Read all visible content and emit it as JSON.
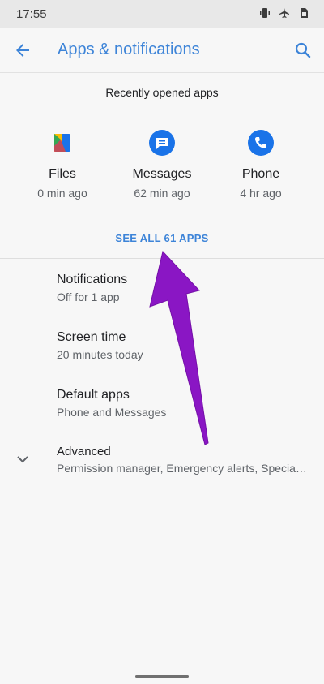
{
  "status_bar": {
    "time": "17:55",
    "icons": [
      "vibrate-icon",
      "airplane-icon",
      "sim-icon"
    ]
  },
  "app_bar": {
    "title": "Apps & notifications",
    "icons": [
      "back-arrow-icon",
      "search-icon"
    ]
  },
  "recent": {
    "title": "Recently opened apps",
    "apps": [
      {
        "name": "Files",
        "time": "0 min ago",
        "icon": "files-icon"
      },
      {
        "name": "Messages",
        "time": "62 min ago",
        "icon": "messages-icon"
      },
      {
        "name": "Phone",
        "time": "4 hr ago",
        "icon": "phone-icon"
      }
    ],
    "see_all": "SEE ALL 61 APPS"
  },
  "settings": [
    {
      "title": "Notifications",
      "subtitle": "Off for 1 app"
    },
    {
      "title": "Screen time",
      "subtitle": "20 minutes today"
    },
    {
      "title": "Default apps",
      "subtitle": "Phone and Messages"
    },
    {
      "title": "Advanced",
      "subtitle": "Permission manager, Emergency alerts, Special app access"
    }
  ],
  "colors": {
    "accent": "#3d84d8",
    "annotation_arrow": "#8a16c4",
    "background": "#f7f7f7"
  }
}
